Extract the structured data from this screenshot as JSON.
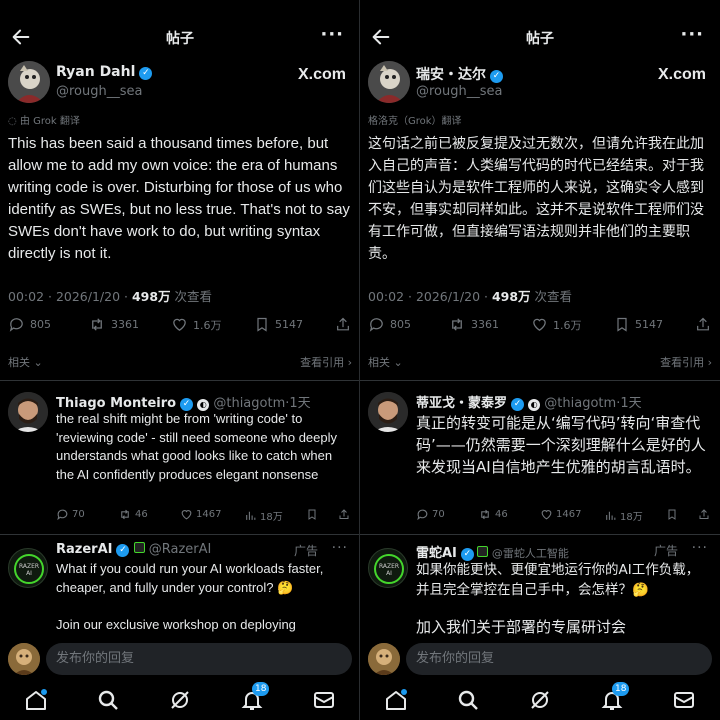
{
  "left": {
    "header_title": "帖子",
    "author": {
      "name": "Ryan Dahl",
      "handle": "@rough__sea",
      "site_badge": "X.com"
    },
    "translated_label": "由 Grok 翻译",
    "body": "This has been said a thousand times before, but allow me to add my own voice: the era of humans writing code is over. Disturbing for those of us who identify as SWEs, but no less true. That's not to say SWEs don't have work to do, but writing syntax directly is not it.",
    "meta": {
      "time": "00:02 · 2026/1/20 · ",
      "views": "498万",
      "views_suffix": " 次查看"
    },
    "actions": {
      "replies": "805",
      "reposts": "3361",
      "likes": "1.6万",
      "bookmarks": "5147"
    },
    "related": "相关",
    "view_quotes": "查看引用 ›",
    "reply1": {
      "name": "Thiago Monteiro",
      "handle": "@thiagotm",
      "time": "·1天",
      "text": "the real shift might be from 'writing code' to 'reviewing code' - still need someone who deeply understands what good looks like to catch when the AI confidently produces elegant nonsense",
      "replies": "70",
      "reposts": "46",
      "likes": "1467",
      "views": "18万"
    },
    "ad": {
      "name": "RazerAI",
      "handle": "@RazerAI",
      "ad_label": "广告",
      "text1": "What if you could run your AI workloads faster, cheaper, and fully under your control? 🤔",
      "text2": "Join our exclusive workshop on deploying"
    },
    "composer_placeholder": "发布你的回复",
    "notif_count": "18"
  },
  "right": {
    "header_title": "帖子",
    "author": {
      "name": "瑞安・达尔",
      "handle": "@rough__sea",
      "site_badge": "X.com"
    },
    "translated_label": "格洛克（Grok）翻译",
    "body": "这句话之前已被反复提及过无数次，但请允许我在此加入自己的声音：人类编写代码的时代已经结束。对于我们这些自认为是软件工程师的人来说，这确实令人感到不安，但事实却同样如此。这并不是说软件工程师们没有工作可做，但直接编写语法规则并非他们的主要职责。",
    "meta": {
      "time": "00:02 · 2026/1/20 · ",
      "views": "498万",
      "views_suffix": " 次查看"
    },
    "actions": {
      "replies": "805",
      "reposts": "3361",
      "likes": "1.6万",
      "bookmarks": "5147"
    },
    "related": "相关",
    "view_quotes": "查看引用 ›",
    "reply1": {
      "name": "蒂亚戈・蒙泰罗",
      "handle": "@thiagotm",
      "time": "·1天",
      "text": "真正的转变可能是从‘编写代码’转向‘审查代码’——仍然需要一个深刻理解什么是好的人来发现当AI自信地产生优雅的胡言乱语时。",
      "replies": "70",
      "reposts": "46",
      "likes": "1467",
      "views": "18万"
    },
    "ad": {
      "name": "雷蛇AI",
      "handle": "@雷蛇人工智能",
      "ad_label": "广告",
      "text1": "如果你能更快、更便宜地运行你的AI工作负载，并且完全掌控在自己手中，会怎样？🤔",
      "text2": "加入我们关于部署的专属研讨会"
    },
    "composer_placeholder": "发布你的回复",
    "notif_count": "18"
  },
  "colors": {
    "background": "#000000",
    "text": "#e7e9ea",
    "muted": "#71767b",
    "accent": "#1d9bf0",
    "input_bg": "#202327"
  }
}
